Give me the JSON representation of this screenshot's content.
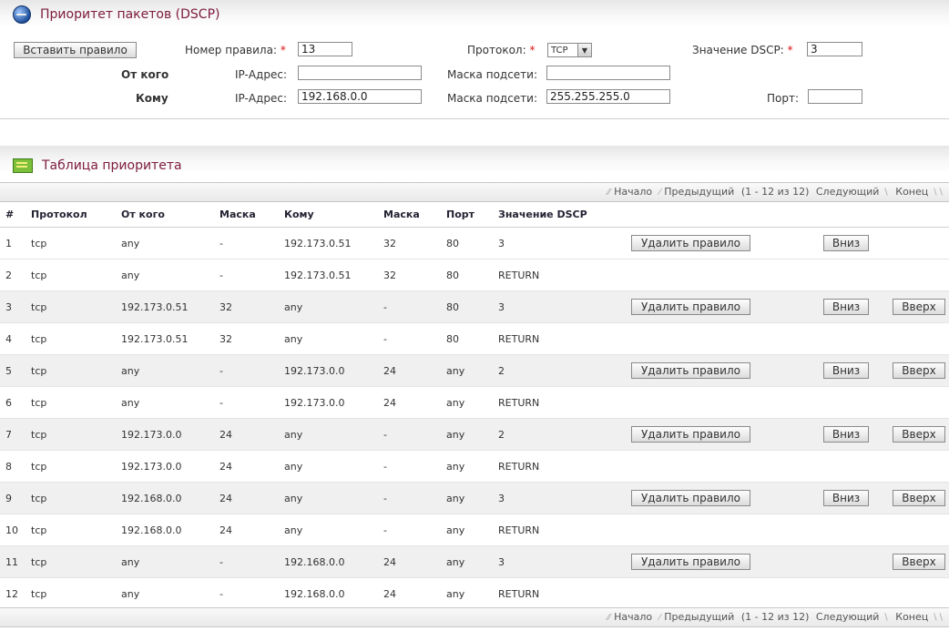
{
  "header": {
    "title": "Приоритет пакетов (DSCP)"
  },
  "form": {
    "insert_button": "Вставить правило",
    "rule_number_label": "Номер правила:",
    "rule_number_value": "13",
    "protocol_label": "Протокол:",
    "protocol_value": "TCP",
    "dscp_label": "Значение DSCP:",
    "dscp_value": "3",
    "from_label": "От кого",
    "to_label": "Кому",
    "ip_label": "IP-Адрес:",
    "mask_label": "Маска подсети:",
    "port_label": "Порт:",
    "from_ip": "",
    "from_mask": "",
    "to_ip": "192.168.0.0",
    "to_mask": "255.255.255.0",
    "to_port": "",
    "required_mark": "*"
  },
  "table_section": {
    "title": "Таблица приоритета"
  },
  "pager": {
    "first": "Начало",
    "prev": "Предыдущий",
    "range": "(1 - 12 из 12)",
    "next": "Следующий",
    "last": "Конец"
  },
  "columns": [
    "#",
    "Протокол",
    "От кого",
    "Маска",
    "Кому",
    "Маска",
    "Порт",
    "Значение DSCP"
  ],
  "actions": {
    "delete": "Удалить правило",
    "down": "Вниз",
    "up": "Вверх"
  },
  "rows": [
    {
      "n": "1",
      "proto": "tcp",
      "from": "any",
      "fmask": "-",
      "to": "192.173.0.51",
      "tmask": "32",
      "port": "80",
      "dscp": "3",
      "del": true,
      "down": true,
      "up": false
    },
    {
      "n": "2",
      "proto": "tcp",
      "from": "any",
      "fmask": "-",
      "to": "192.173.0.51",
      "tmask": "32",
      "port": "80",
      "dscp": "RETURN",
      "del": false,
      "down": false,
      "up": false
    },
    {
      "n": "3",
      "proto": "tcp",
      "from": "192.173.0.51",
      "fmask": "32",
      "to": "any",
      "tmask": "-",
      "port": "80",
      "dscp": "3",
      "del": true,
      "down": true,
      "up": true
    },
    {
      "n": "4",
      "proto": "tcp",
      "from": "192.173.0.51",
      "fmask": "32",
      "to": "any",
      "tmask": "-",
      "port": "80",
      "dscp": "RETURN",
      "del": false,
      "down": false,
      "up": false
    },
    {
      "n": "5",
      "proto": "tcp",
      "from": "any",
      "fmask": "-",
      "to": "192.173.0.0",
      "tmask": "24",
      "port": "any",
      "dscp": "2",
      "del": true,
      "down": true,
      "up": true
    },
    {
      "n": "6",
      "proto": "tcp",
      "from": "any",
      "fmask": "-",
      "to": "192.173.0.0",
      "tmask": "24",
      "port": "any",
      "dscp": "RETURN",
      "del": false,
      "down": false,
      "up": false
    },
    {
      "n": "7",
      "proto": "tcp",
      "from": "192.173.0.0",
      "fmask": "24",
      "to": "any",
      "tmask": "-",
      "port": "any",
      "dscp": "2",
      "del": true,
      "down": true,
      "up": true
    },
    {
      "n": "8",
      "proto": "tcp",
      "from": "192.173.0.0",
      "fmask": "24",
      "to": "any",
      "tmask": "-",
      "port": "any",
      "dscp": "RETURN",
      "del": false,
      "down": false,
      "up": false
    },
    {
      "n": "9",
      "proto": "tcp",
      "from": "192.168.0.0",
      "fmask": "24",
      "to": "any",
      "tmask": "-",
      "port": "any",
      "dscp": "3",
      "del": true,
      "down": true,
      "up": true
    },
    {
      "n": "10",
      "proto": "tcp",
      "from": "192.168.0.0",
      "fmask": "24",
      "to": "any",
      "tmask": "-",
      "port": "any",
      "dscp": "RETURN",
      "del": false,
      "down": false,
      "up": false
    },
    {
      "n": "11",
      "proto": "tcp",
      "from": "any",
      "fmask": "-",
      "to": "192.168.0.0",
      "tmask": "24",
      "port": "any",
      "dscp": "3",
      "del": true,
      "down": false,
      "up": true
    },
    {
      "n": "12",
      "proto": "tcp",
      "from": "any",
      "fmask": "-",
      "to": "192.168.0.0",
      "tmask": "24",
      "port": "any",
      "dscp": "RETURN",
      "del": false,
      "down": false,
      "up": false
    }
  ]
}
